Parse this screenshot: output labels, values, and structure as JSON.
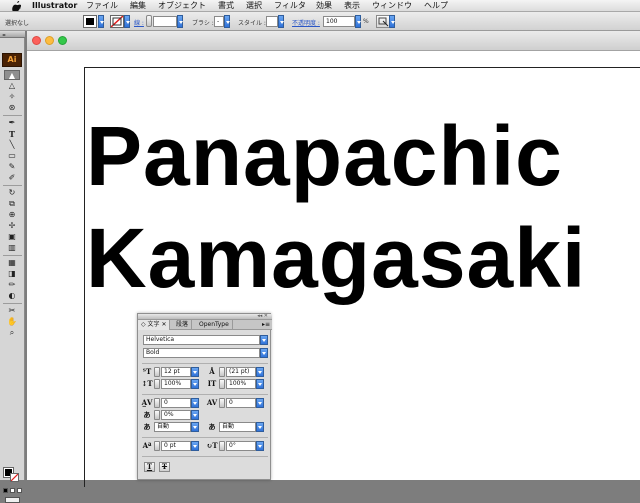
{
  "menubar": {
    "app_name": "Illustrator",
    "items": [
      "ファイル",
      "編集",
      "オブジェクト",
      "書式",
      "選択",
      "フィルタ",
      "効果",
      "表示",
      "ウィンドウ",
      "ヘルプ"
    ]
  },
  "controlbar": {
    "selection_label": "選択なし",
    "stroke_label": "線 :",
    "brush_label": "ブラシ :",
    "brush_value": "-",
    "style_label": "スタイル :",
    "opacity_label": "不透明度 :",
    "opacity_value": "100",
    "opacity_unit": "%"
  },
  "toolbox": {
    "logo": "Ai",
    "tool_glyphs": [
      "▲",
      "△",
      "✧",
      "⊛",
      "✒",
      "T",
      "╲",
      "▭",
      "✎",
      "✐",
      "↻",
      "⧉",
      "⊕",
      "✢",
      "▣",
      "▥",
      "▦",
      "◨",
      "✏",
      "◐",
      "✂",
      "✋",
      "⌕"
    ]
  },
  "artwork": {
    "line1": "Panapachic",
    "line2": "Kamagasaki"
  },
  "character_panel": {
    "tabs": [
      "文字",
      "段落",
      "OpenType"
    ],
    "font_family": "Helvetica",
    "font_style": "Bold",
    "font_size": "12 pt",
    "leading": "(21 pt)",
    "vertical_scale": "100%",
    "horizontal_scale": "100%",
    "kerning": "0",
    "tracking": "0",
    "tsume": "0%",
    "aki_left": "自動",
    "aki_right": "自動",
    "baseline_shift": "0 pt",
    "rotation": "0°"
  },
  "colors": {
    "accent_blue": "#2f72d9",
    "artwork_text": "#000000",
    "ai_logo_bg": "#4a2204",
    "ai_logo_fg": "#f3a23a"
  }
}
